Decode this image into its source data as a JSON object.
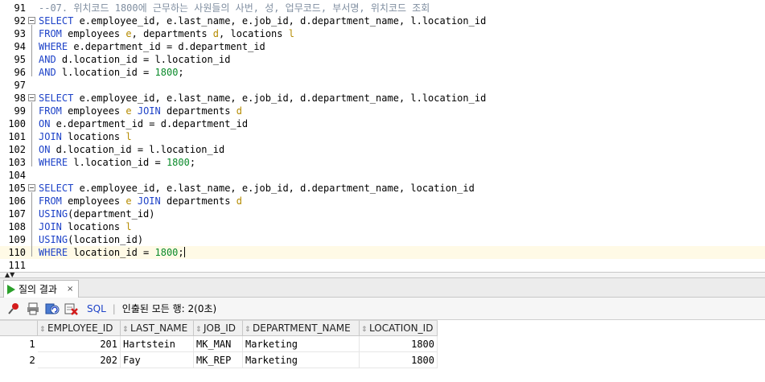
{
  "editor": {
    "lines": [
      {
        "no": "91",
        "fold": false,
        "tokens": [
          {
            "t": "--07. 위치코드 1800에 근무하는 사원들의 사번, 성, 업무코드, 부서명, 위치코드 조회",
            "c": "cmt"
          }
        ]
      },
      {
        "no": "92",
        "fold": true,
        "tokens": [
          {
            "t": "SELECT",
            "c": "kw"
          },
          {
            "t": " e.employee_id, e.last_name, e.job_id, d.department_name, l.location_id",
            "c": ""
          }
        ]
      },
      {
        "no": "93",
        "fold": false,
        "tokens": [
          {
            "t": "FROM",
            "c": "kw"
          },
          {
            "t": " employees ",
            "c": ""
          },
          {
            "t": "e",
            "c": "al"
          },
          {
            "t": ", departments ",
            "c": ""
          },
          {
            "t": "d",
            "c": "al"
          },
          {
            "t": ", locations ",
            "c": ""
          },
          {
            "t": "l",
            "c": "al"
          }
        ]
      },
      {
        "no": "94",
        "fold": false,
        "tokens": [
          {
            "t": "WHERE",
            "c": "kw"
          },
          {
            "t": " e.department_id = d.department_id",
            "c": ""
          }
        ]
      },
      {
        "no": "95",
        "fold": false,
        "tokens": [
          {
            "t": "AND",
            "c": "kw"
          },
          {
            "t": " d.location_id = l.location_id",
            "c": ""
          }
        ]
      },
      {
        "no": "96",
        "fold": false,
        "tokens": [
          {
            "t": "AND",
            "c": "kw"
          },
          {
            "t": " l.location_id = ",
            "c": ""
          },
          {
            "t": "1800",
            "c": "num"
          },
          {
            "t": ";",
            "c": ""
          }
        ]
      },
      {
        "no": "97",
        "fold": false,
        "tokens": []
      },
      {
        "no": "98",
        "fold": true,
        "tokens": [
          {
            "t": "SELECT",
            "c": "kw"
          },
          {
            "t": " e.employee_id, e.last_name, e.job_id, d.department_name, l.location_id",
            "c": ""
          }
        ]
      },
      {
        "no": "99",
        "fold": false,
        "tokens": [
          {
            "t": "FROM",
            "c": "kw"
          },
          {
            "t": " employees ",
            "c": ""
          },
          {
            "t": "e",
            "c": "al"
          },
          {
            "t": " ",
            "c": ""
          },
          {
            "t": "JOIN",
            "c": "kw"
          },
          {
            "t": " departments ",
            "c": ""
          },
          {
            "t": "d",
            "c": "al"
          }
        ]
      },
      {
        "no": "100",
        "fold": false,
        "tokens": [
          {
            "t": "ON",
            "c": "kw"
          },
          {
            "t": " e.department_id = d.department_id",
            "c": ""
          }
        ]
      },
      {
        "no": "101",
        "fold": false,
        "tokens": [
          {
            "t": "JOIN",
            "c": "kw"
          },
          {
            "t": " locations ",
            "c": ""
          },
          {
            "t": "l",
            "c": "al"
          }
        ]
      },
      {
        "no": "102",
        "fold": false,
        "tokens": [
          {
            "t": "ON",
            "c": "kw"
          },
          {
            "t": " d.location_id = l.location_id",
            "c": ""
          }
        ]
      },
      {
        "no": "103",
        "fold": false,
        "tokens": [
          {
            "t": "WHERE",
            "c": "kw"
          },
          {
            "t": " l.location_id = ",
            "c": ""
          },
          {
            "t": "1800",
            "c": "num"
          },
          {
            "t": ";",
            "c": ""
          }
        ]
      },
      {
        "no": "104",
        "fold": false,
        "tokens": []
      },
      {
        "no": "105",
        "fold": true,
        "tokens": [
          {
            "t": "SELECT",
            "c": "kw"
          },
          {
            "t": " e.employee_id, e.last_name, e.job_id, d.department_name, location_id",
            "c": ""
          }
        ]
      },
      {
        "no": "106",
        "fold": false,
        "tokens": [
          {
            "t": "FROM",
            "c": "kw"
          },
          {
            "t": " employees ",
            "c": ""
          },
          {
            "t": "e",
            "c": "al"
          },
          {
            "t": " ",
            "c": ""
          },
          {
            "t": "JOIN",
            "c": "kw"
          },
          {
            "t": " departments ",
            "c": ""
          },
          {
            "t": "d",
            "c": "al"
          }
        ]
      },
      {
        "no": "107",
        "fold": false,
        "tokens": [
          {
            "t": "USING",
            "c": "kw"
          },
          {
            "t": "(department_id)",
            "c": ""
          }
        ]
      },
      {
        "no": "108",
        "fold": false,
        "tokens": [
          {
            "t": "JOIN",
            "c": "kw"
          },
          {
            "t": " locations ",
            "c": ""
          },
          {
            "t": "l",
            "c": "al"
          }
        ]
      },
      {
        "no": "109",
        "fold": false,
        "tokens": [
          {
            "t": "USING",
            "c": "kw"
          },
          {
            "t": "(location_id)",
            "c": ""
          }
        ]
      },
      {
        "no": "110",
        "fold": false,
        "current": true,
        "tokens": [
          {
            "t": "WHERE",
            "c": "kw"
          },
          {
            "t": " location_id = ",
            "c": ""
          },
          {
            "t": "1800",
            "c": "num"
          },
          {
            "t": ";",
            "c": ""
          }
        ]
      },
      {
        "no": "111",
        "fold": false,
        "tokens": []
      }
    ]
  },
  "results": {
    "tab_label": "질의 결과",
    "tab_close": "×",
    "toolbar": {
      "sql_label": "SQL",
      "separator": "|",
      "status": "인출된 모든 행: 2(0초)"
    },
    "columns": [
      "EMPLOYEE_ID",
      "LAST_NAME",
      "JOB_ID",
      "DEPARTMENT_NAME",
      "LOCATION_ID"
    ],
    "rows": [
      {
        "num": "1",
        "cells": [
          "201",
          "Hartstein",
          "MK_MAN",
          "Marketing",
          "1800"
        ]
      },
      {
        "num": "2",
        "cells": [
          "202",
          "Fay",
          "MK_REP",
          "Marketing",
          "1800"
        ]
      }
    ]
  },
  "colors": {
    "keyword": "#1d42c8",
    "alias": "#b58b00",
    "number": "#0a8a2a",
    "comment": "#7f8ea0",
    "current_line": "#fffae6"
  },
  "icons": [
    "fold-toggle-icon",
    "run-icon",
    "pin-icon",
    "print-icon",
    "refresh-icon",
    "delete-icon",
    "sort-icon"
  ]
}
